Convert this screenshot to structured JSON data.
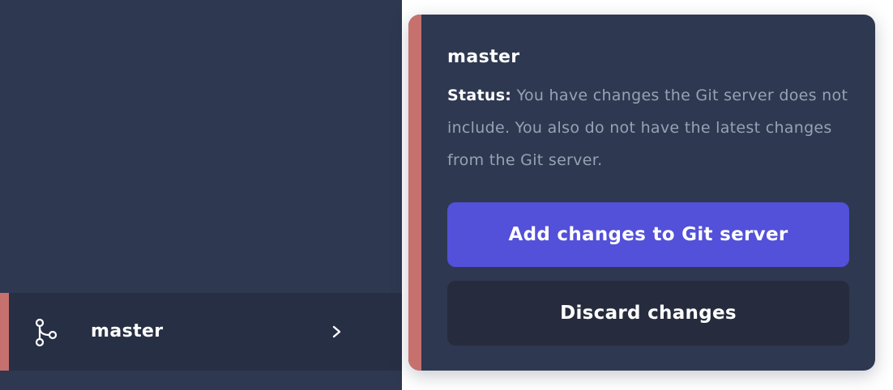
{
  "sidebar": {
    "branch_row": {
      "label": "master",
      "icon": "git-branch-icon",
      "chevron": "chevron-right-icon"
    }
  },
  "popover": {
    "title": "master",
    "status_label": "Status:",
    "status_text": "You have changes the Git server does not include. You also do not have the latest changes from the Git server.",
    "primary_button": "Add changes to Git server",
    "secondary_button": "Discard changes"
  },
  "colors": {
    "sidebar_bg": "#2e3850",
    "row_bg": "#272f44",
    "accent": "#c6716d",
    "primary": "#5350d9",
    "secondary": "#262c3d",
    "muted_text": "#99a1b3"
  }
}
